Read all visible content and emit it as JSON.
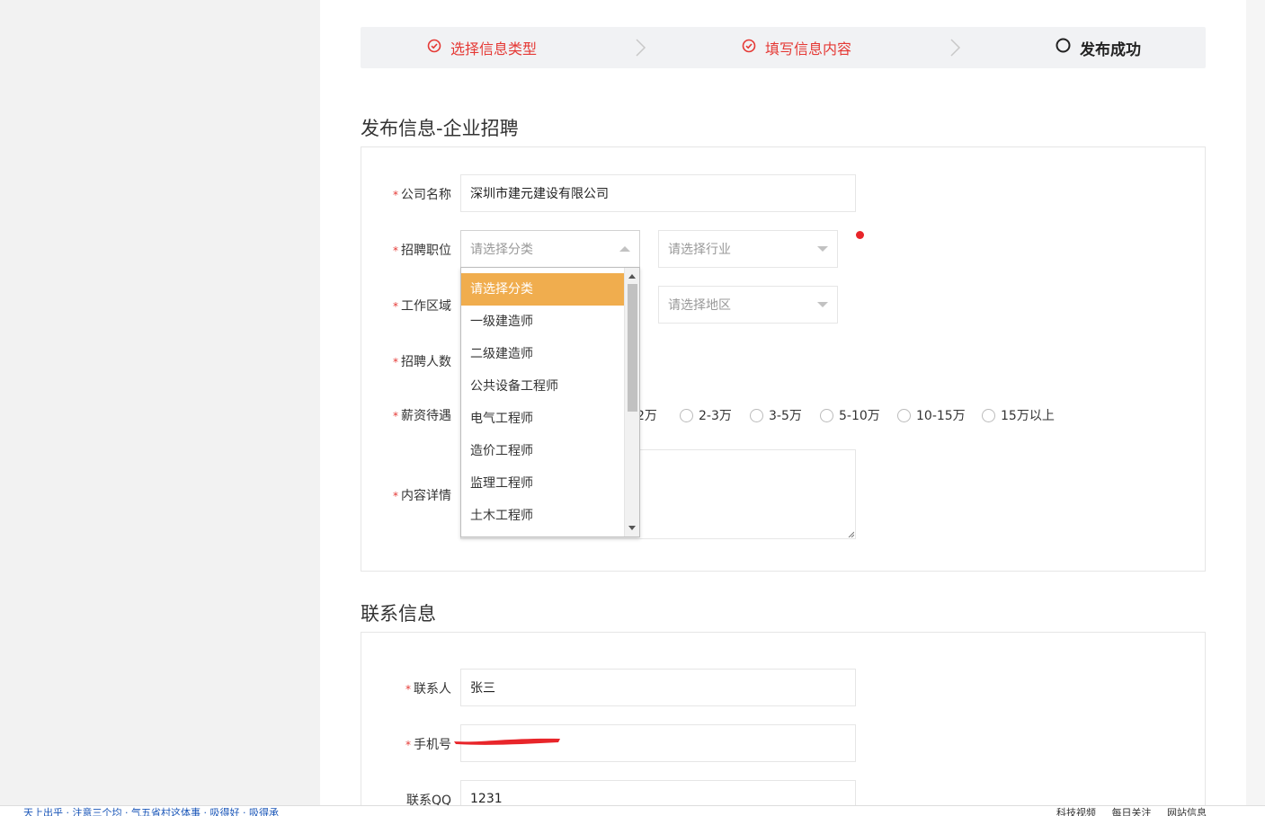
{
  "steps": [
    {
      "label": "选择信息类型",
      "state": "done"
    },
    {
      "label": "填写信息内容",
      "state": "done"
    },
    {
      "label": "发布成功",
      "state": "active"
    }
  ],
  "colors": {
    "accent_red": "#e53935",
    "selected_orange": "#f0ad4e"
  },
  "job_section": {
    "title": "发布信息-企业招聘",
    "company": {
      "label": "公司名称",
      "value": "深圳市建元建设有限公司"
    },
    "position": {
      "label": "招聘职位",
      "category_placeholder": "请选择分类",
      "industry_placeholder": "请选择行业"
    },
    "area": {
      "label": "工作区域",
      "region_placeholder": "请选择地区"
    },
    "headcount": {
      "label": "招聘人数"
    },
    "salary": {
      "label": "薪资待遇",
      "options": [
        "2万",
        "2-3万",
        "3-5万",
        "5-10万",
        "10-15万",
        "15万以上"
      ]
    },
    "details": {
      "label": "内容详情"
    }
  },
  "category_dropdown": {
    "items": [
      "请选择分类",
      "一级建造师",
      "二级建造师",
      "公共设备工程师",
      "电气工程师",
      "造价工程师",
      "监理工程师",
      "土木工程师"
    ],
    "selected_index": 0
  },
  "contact_section": {
    "title": "联系信息",
    "contact_person": {
      "label": "联系人",
      "value": "张三"
    },
    "phone": {
      "label": "手机号"
    },
    "qq": {
      "label": "联系QQ",
      "value": "1231"
    }
  },
  "statusbar": {
    "left_text": "天上出乎 · 注意三个均 · 气五省村这体事 · 吸得好 · 吸得承",
    "right_items": [
      "科技视频",
      "每日关注",
      "网站信息"
    ]
  },
  "icons": {
    "step_done": "check-circle-icon",
    "step_active": "circle-icon",
    "dropdown_caret": "caret-down-icon"
  }
}
